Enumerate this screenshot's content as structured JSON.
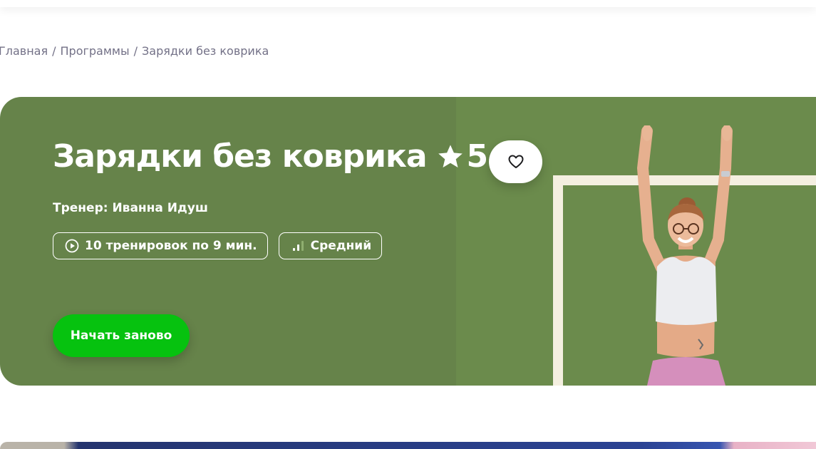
{
  "breadcrumb": {
    "items": [
      "Главная",
      "Программы",
      "Зарядки без коврика"
    ],
    "separator": "/"
  },
  "program": {
    "title": "Зарядки без коврика",
    "rating": "5",
    "trainer": "Тренер: Иванна Идуш",
    "workouts_chip": "10 тренировок по 9 мин.",
    "level_chip": "Средний",
    "start_button": "Начать заново"
  },
  "icons": {
    "star": "star-icon",
    "favorite": "heart-icon",
    "workouts": "play-circle-icon",
    "level": "level-bars-icon"
  },
  "colors": {
    "hero_bg": "#66834a",
    "accent_green": "#06c20f",
    "frame": "#f4efe0"
  }
}
